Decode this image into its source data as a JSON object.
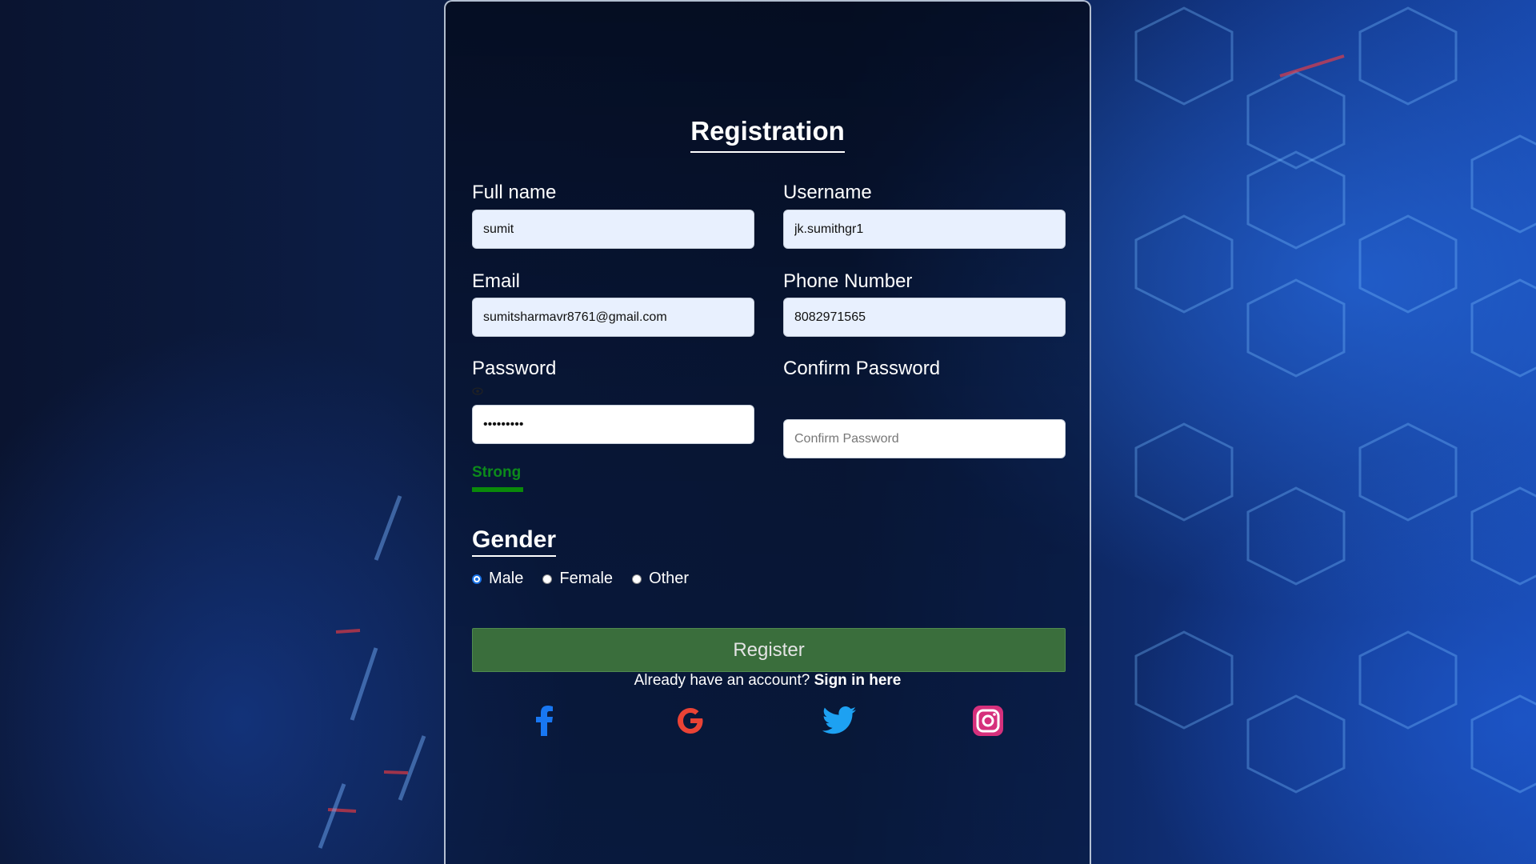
{
  "form": {
    "title": "Registration",
    "full_name": {
      "label": "Full name",
      "value": "sumit"
    },
    "username": {
      "label": "Username",
      "value": "jk.sumithgr1"
    },
    "email": {
      "label": "Email",
      "value": "sumitsharmavr8761@gmail.com"
    },
    "phone": {
      "label": "Phone Number",
      "value": "8082971565"
    },
    "password": {
      "label": "Password",
      "value": "sumit1234"
    },
    "confirm_password": {
      "label": "Confirm Password",
      "placeholder": "Confirm Password",
      "value": ""
    },
    "strength": {
      "text": "Strong",
      "color": "#0c8a1b"
    },
    "gender": {
      "title": "Gender",
      "options": [
        "Male",
        "Female",
        "Other"
      ],
      "selected": "Male"
    },
    "register_label": "Register",
    "signin_prompt": "Already have an account?",
    "signin_link": "Sign in here"
  },
  "social": {
    "facebook": {
      "icon": "facebook-icon",
      "color": "#1877f2"
    },
    "google": {
      "icon": "google-icon",
      "color": "#ea4335"
    },
    "twitter": {
      "icon": "twitter-icon",
      "color": "#1da1f2"
    },
    "instagram": {
      "icon": "instagram-icon",
      "color": "#d6307c"
    }
  },
  "colors": {
    "register_button": "#3a6e3c",
    "input_autofill": "#e8f0fe"
  }
}
